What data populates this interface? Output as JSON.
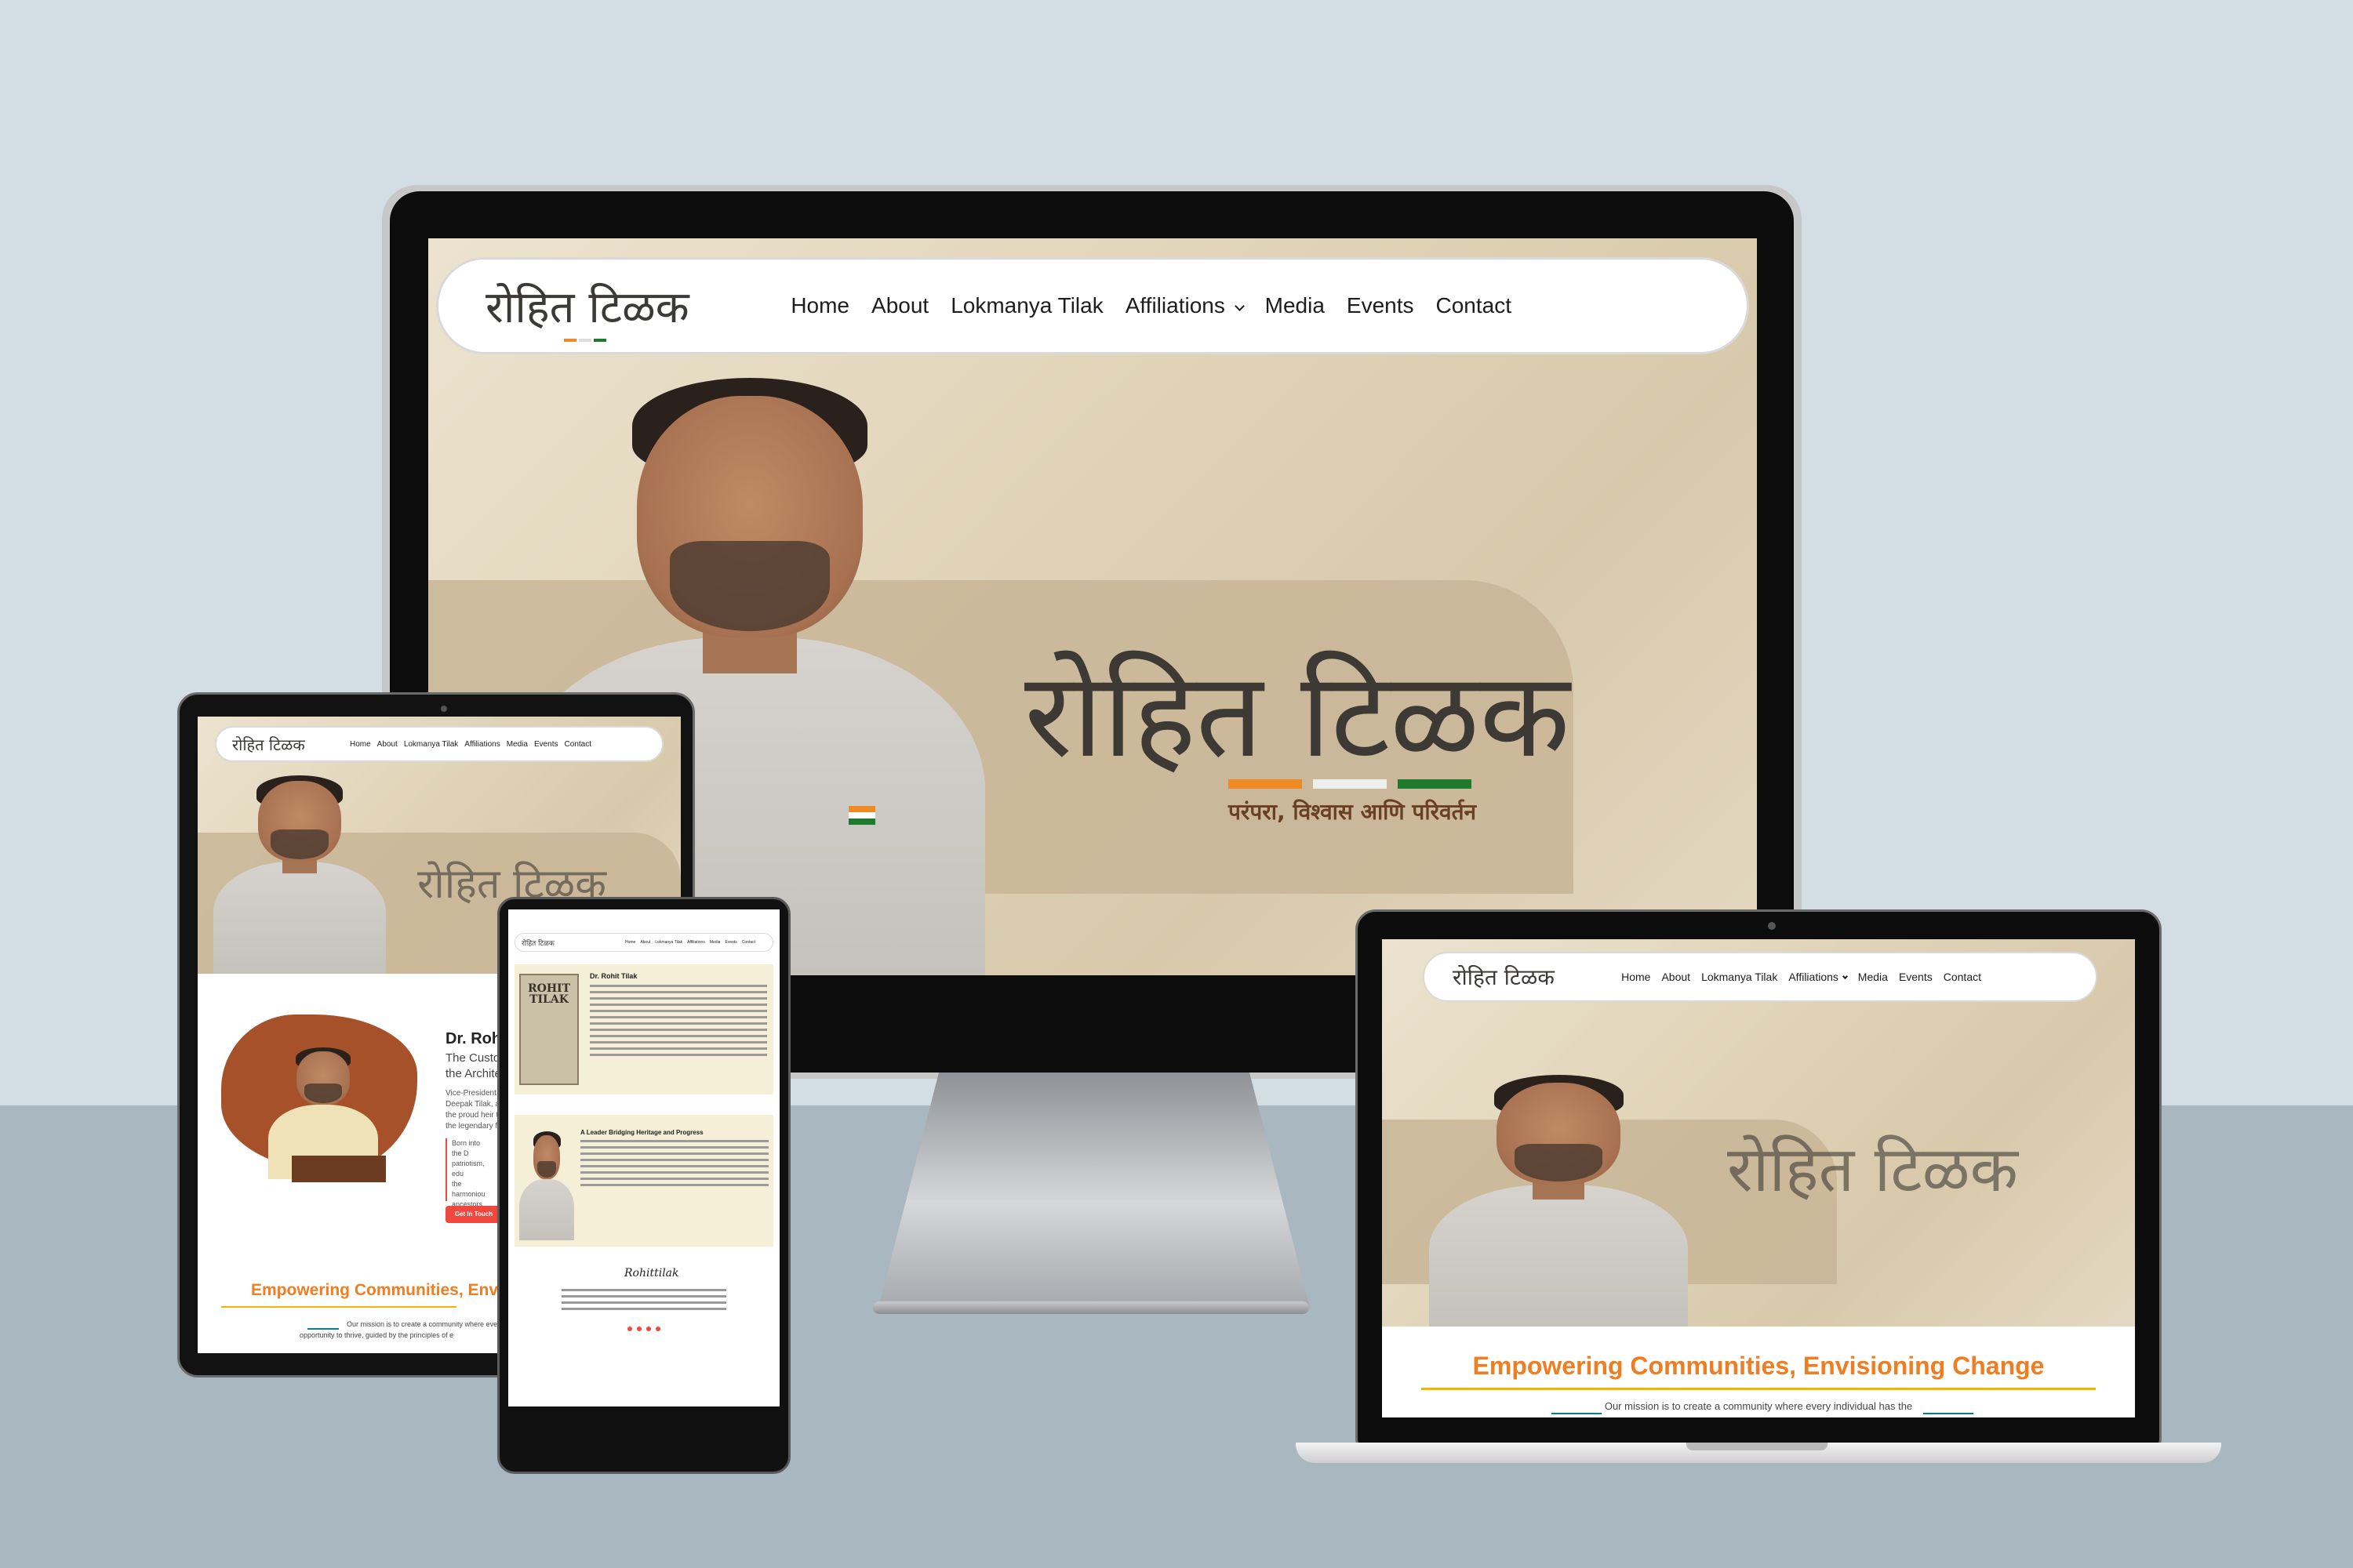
{
  "site": {
    "logo_text": "रोहित टिळक",
    "nav": [
      "Home",
      "About",
      "Lokmanya Tilak",
      "Affiliations",
      "Media",
      "Events",
      "Contact"
    ],
    "hero": {
      "script_title": "रोहित टिळक",
      "tagline": "परंपरा, विश्वास आणि परिवर्तन"
    },
    "mission_heading": "Empowering Communities, Envisioning Change",
    "mission_heading_cut": "Empowering Communities, Env",
    "mission_text": "Our mission is to create a community where every individual has the",
    "mission_text_tablet_1": "Our mission is to create a community where every indi",
    "mission_text_tablet_2": "opportunity to thrive, guided by the principles of e",
    "about": {
      "name_cut": "Dr. Rohi",
      "subtitle_1": "The Custod",
      "subtitle_2": "the Archite",
      "line_1": "Vice-President of",
      "line_2": "Deepak Tilak, a d",
      "line_3": "the proud heir to",
      "line_4": "the legendary free",
      "quote_1": "Born into the D",
      "quote_2": "patriotism, edu",
      "quote_3": "the harmoniou",
      "quote_4": "ancestors chan",
      "cta": "Get In Touch"
    },
    "phone": {
      "about_heading": "Dr. Rohit Tilak",
      "book_title_1": "ROHIT",
      "book_title_2": "TILAK",
      "leader_heading": "A Leader Bridging Heritage and Progress",
      "footer_signature": "Rohittilak"
    }
  },
  "colors": {
    "saffron": "#f08a24",
    "white": "#eeeeee",
    "green": "#1f7a2e",
    "accent_orange": "#ef7d22",
    "cta_red": "#f0483e"
  }
}
